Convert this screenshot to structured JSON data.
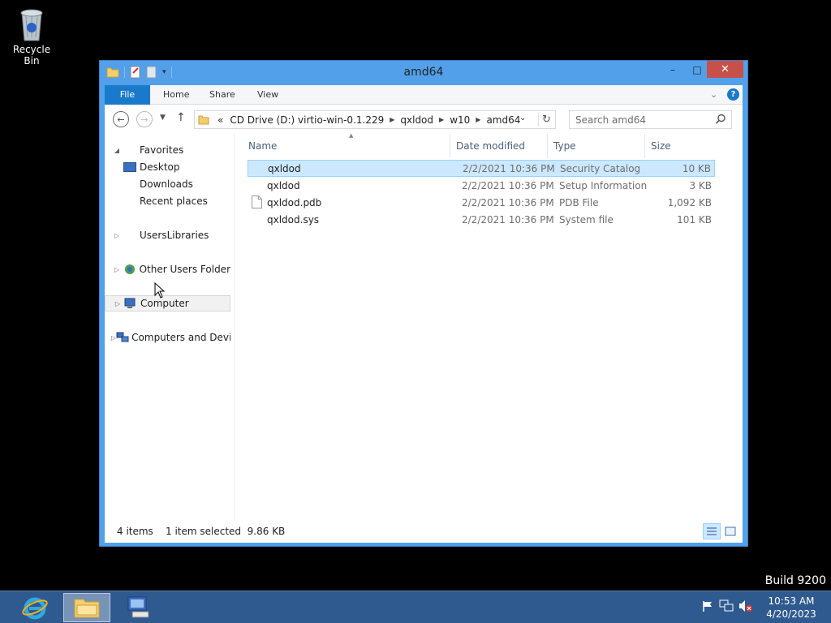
{
  "desktop": {
    "recycle_bin_label": "Recycle Bin",
    "build": "Build 9200"
  },
  "window": {
    "title": "amd64",
    "controls": {
      "minimize": "–",
      "maximize": "□",
      "close": "✕"
    }
  },
  "ribbon": {
    "tabs": [
      "File",
      "Home",
      "Share",
      "View"
    ],
    "help": "?"
  },
  "address": {
    "overflow": "«",
    "crumbs": [
      "CD Drive (D:) virtio-win-0.1.229",
      "qxldod",
      "w10",
      "amd64"
    ]
  },
  "search": {
    "placeholder": "Search amd64"
  },
  "nav_pane": {
    "favorites": "Favorites",
    "desktop": "Desktop",
    "downloads": "Downloads",
    "recent": "Recent places",
    "user_libraries": "UsersLibraries",
    "other_users": "Other Users Folder",
    "computer": "Computer",
    "computers_devices": "Computers and Devices"
  },
  "columns": {
    "name": "Name",
    "date": "Date modified",
    "type": "Type",
    "size": "Size"
  },
  "files": [
    {
      "name": "qxldod",
      "date": "2/2/2021 10:36 PM",
      "type": "Security Catalog",
      "size": "10 KB",
      "selected": true
    },
    {
      "name": "qxldod",
      "date": "2/2/2021 10:36 PM",
      "type": "Setup Information",
      "size": "3 KB",
      "selected": false
    },
    {
      "name": "qxldod.pdb",
      "date": "2/2/2021 10:36 PM",
      "type": "PDB File",
      "size": "1,092 KB",
      "selected": false
    },
    {
      "name": "qxldod.sys",
      "date": "2/2/2021 10:36 PM",
      "type": "System file",
      "size": "101 KB",
      "selected": false
    }
  ],
  "status": {
    "count": "4 items",
    "selection": "1 item selected  9.86 KB"
  },
  "taskbar": {
    "time": "10:53 AM",
    "date": "4/20/2023"
  },
  "icons": {
    "recycle_bin": "recycle-bin-icon",
    "ie": "internet-explorer-icon",
    "explorer": "file-explorer-icon",
    "server_manager": "server-manager-icon"
  }
}
